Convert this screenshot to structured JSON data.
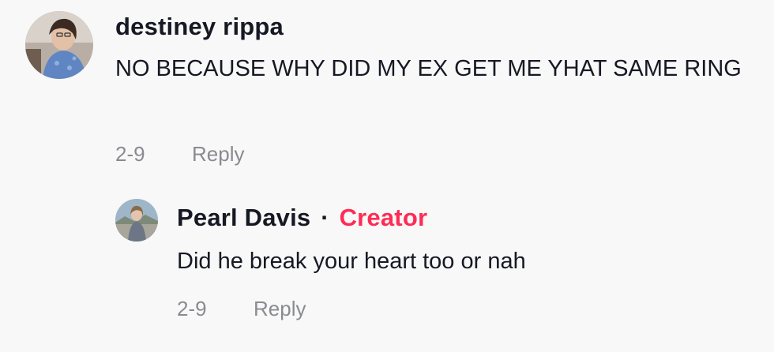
{
  "comments": [
    {
      "username": "destiney rippa",
      "text": "NO BECAUSE WHY DID MY EX GET ME YHAT SAME RING",
      "date": "2-9",
      "reply_label": "Reply",
      "avatar_icon": "user-photo-avatar"
    }
  ],
  "replies": [
    {
      "username": "Pearl Davis",
      "separator": "·",
      "badge": "Creator",
      "text": "Did he break your heart too or nah",
      "date": "2-9",
      "reply_label": "Reply",
      "avatar_icon": "user-photo-avatar"
    }
  ],
  "colors": {
    "background": "#f8f8f8",
    "primary_text": "#161823",
    "secondary_text": "#8a8b91",
    "creator_badge": "#fe2c55"
  }
}
